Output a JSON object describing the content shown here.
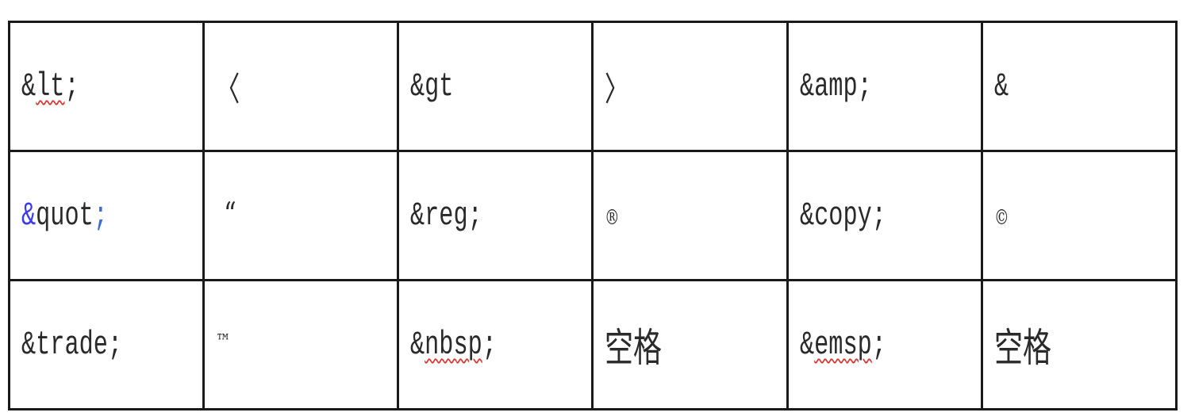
{
  "table": {
    "rows": [
      {
        "cells": [
          {
            "text": "&lt;"
          },
          {
            "text": "〈"
          },
          {
            "text": "&gt"
          },
          {
            "text": "〉"
          },
          {
            "text": "&amp;"
          },
          {
            "text": "&"
          }
        ]
      },
      {
        "cells": [
          {
            "prefix": "&",
            "rest": "quot",
            "suffix": ";"
          },
          {
            "text": "“"
          },
          {
            "text": "&reg;"
          },
          {
            "text": "®"
          },
          {
            "text": "&copy;"
          },
          {
            "text": "©"
          }
        ]
      },
      {
        "cells": [
          {
            "text": "&trade;"
          },
          {
            "text": "™"
          },
          {
            "text": "&nbsp;"
          },
          {
            "text": "空格"
          },
          {
            "text": "&emsp;"
          },
          {
            "text": "空格"
          }
        ]
      }
    ]
  },
  "colors": {
    "border": "#1a1a1a",
    "text": "#2a2a2a",
    "spellcheck": "#e0302a",
    "link_blue": "#3a3af0"
  }
}
